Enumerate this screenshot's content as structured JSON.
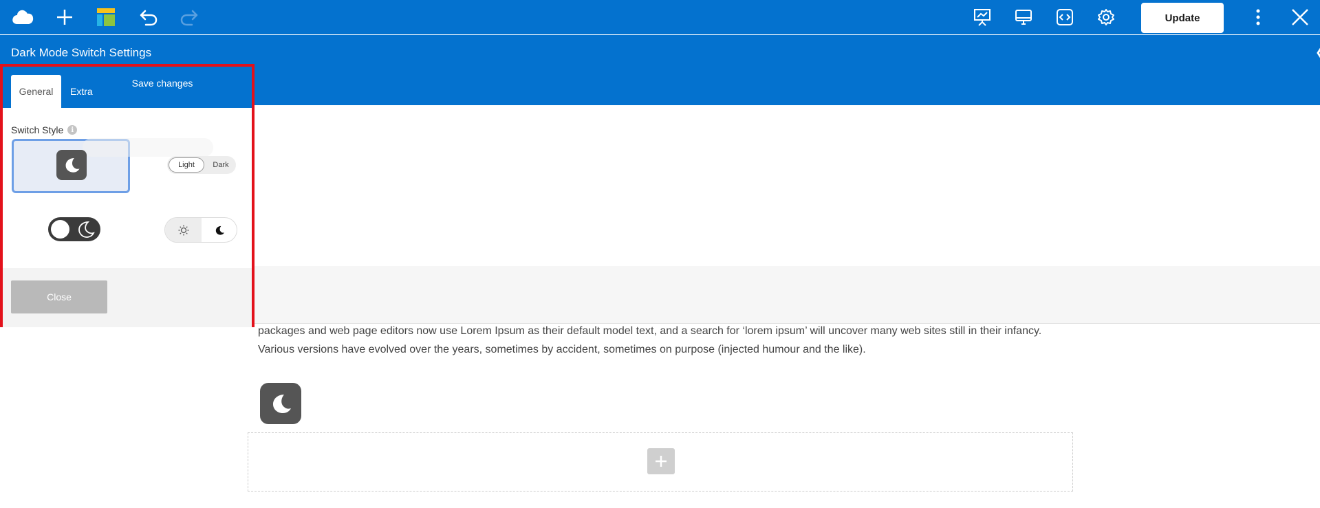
{
  "toolbar": {
    "icons": [
      "cloud-logo-icon",
      "plus-icon",
      "layout-blocks-icon",
      "undo-icon",
      "redo-icon",
      "presentation-icon",
      "desktop-icon",
      "code-icon",
      "gear-icon",
      "more-vertical-icon",
      "close-icon"
    ],
    "update_label": "Update"
  },
  "settings": {
    "title": "Dark Mode Switch Settings",
    "tabs": [
      {
        "label": "General",
        "active": true
      },
      {
        "label": "Extra",
        "active": false
      }
    ],
    "switch_style": {
      "label": "Switch Style",
      "options": [
        {
          "name": "moon-square",
          "selected": true
        },
        {
          "name": "light-dark-pill",
          "light_label": "Light",
          "dark_label": "Dark",
          "selected": false
        },
        {
          "name": "dark-toggle",
          "selected": false
        },
        {
          "name": "sun-moon-pill",
          "selected": false
        }
      ]
    },
    "close_label": "Close",
    "save_label": "Save changes"
  },
  "canvas": {
    "body_text": "packages and web page editors now use Lorem Ipsum as their default model text, and a search for ‘lorem ipsum’ will uncover many web sites still in their infancy. Various versions have evolved over the years, sometimes by accident, sometimes on purpose (injected humour and the like)."
  },
  "colors": {
    "brand_blue": "#0472cf",
    "highlight_red": "#e3111b",
    "selected_border": "#6e9fe6",
    "moon_bg": "#555555"
  }
}
